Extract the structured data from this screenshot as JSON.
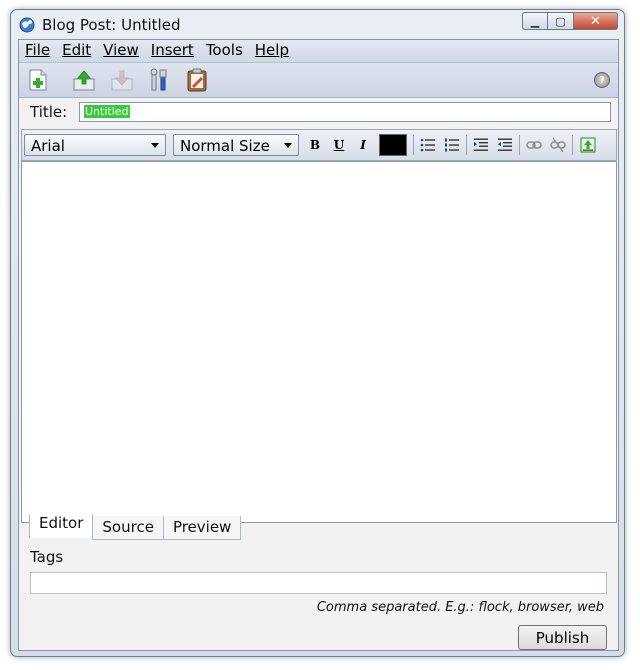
{
  "window": {
    "title": "Blog Post: Untitled"
  },
  "menubar": {
    "items": [
      {
        "label": "File"
      },
      {
        "label": "Edit"
      },
      {
        "label": "View"
      },
      {
        "label": "Insert"
      },
      {
        "label": "Tools"
      },
      {
        "label": "Help"
      }
    ]
  },
  "toolbar": {
    "icons": [
      "new-post-icon",
      "upload-icon",
      "download-icon",
      "tools-icon",
      "clipboard-icon",
      "help-icon"
    ],
    "help_glyph": "?"
  },
  "post": {
    "title_label": "Title:",
    "title_value": "Untitled"
  },
  "format": {
    "font": "Arial",
    "size": "Normal Size",
    "bold": "B",
    "underline": "U",
    "italic": "I",
    "text_color": "#000000"
  },
  "tabs": [
    {
      "label": "Editor",
      "active": true
    },
    {
      "label": "Source",
      "active": false
    },
    {
      "label": "Preview",
      "active": false
    }
  ],
  "tags": {
    "label": "Tags",
    "value": "",
    "hint": "Comma separated. E.g.: flock, browser, web"
  },
  "publish_label": "Publish",
  "colors": {
    "selection": "#38cd38",
    "close_button": "#c2452b"
  }
}
